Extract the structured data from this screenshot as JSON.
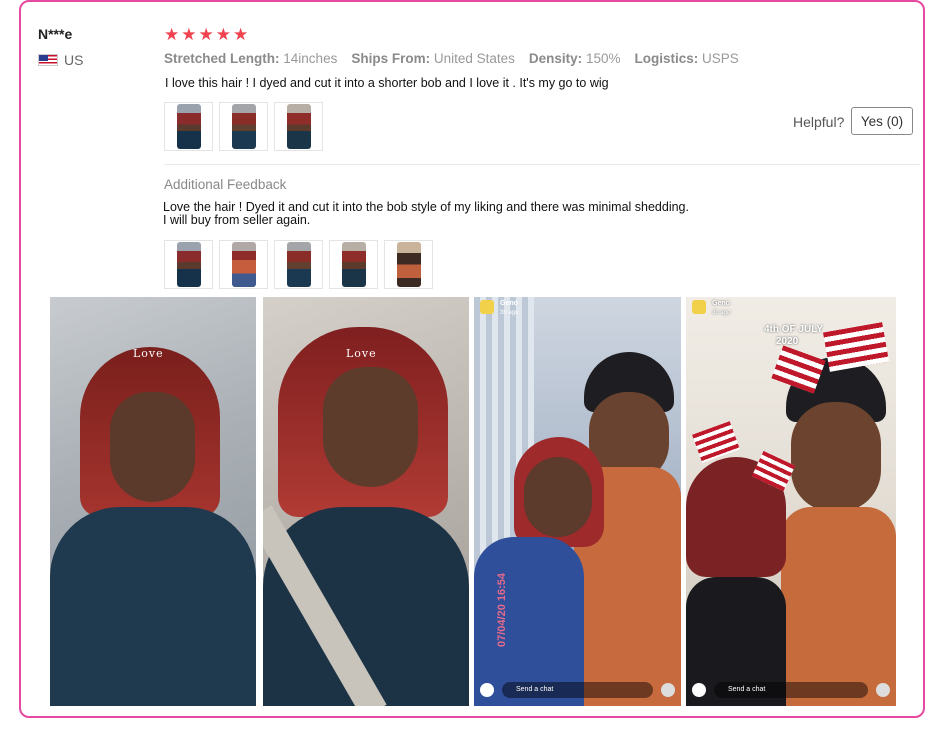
{
  "reviewer": {
    "name": "N***e",
    "country": "US"
  },
  "rating": {
    "stars": 5,
    "max": 5
  },
  "attributes": [
    {
      "label": "Stretched Length:",
      "value": "14inches"
    },
    {
      "label": "Ships From:",
      "value": "United States"
    },
    {
      "label": "Density:",
      "value": "150%"
    },
    {
      "label": "Logistics:",
      "value": "USPS"
    }
  ],
  "review": {
    "text": "I love this hair ! I dyed and cut it into a shorter bob and I love it . It's my go to wig"
  },
  "helpful": {
    "label": "Helpful?",
    "button": "Yes (0)"
  },
  "additional": {
    "title": "Additional Feedback",
    "line1": "Love the hair ! Dyed it and cut it into the bob style of my liking and there was minimal shedding.",
    "line2": "I will buy from seller again."
  },
  "photo_overlays": {
    "love": "Love",
    "snap_name": "Geno",
    "snap_time": "3h ago",
    "send_chat": "Send a chat",
    "fourth_title": "4th OF JULY",
    "fourth_year": "2020",
    "date_stamp": "07/04/20 16:54"
  }
}
